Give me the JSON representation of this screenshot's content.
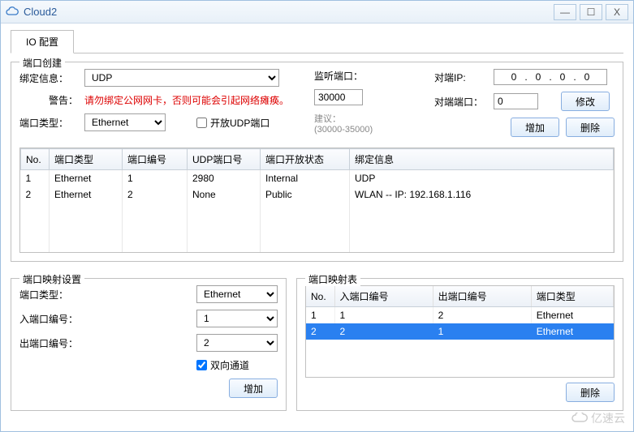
{
  "window": {
    "title": "Cloud2"
  },
  "tabs": {
    "io_config": "IO 配置"
  },
  "port_create": {
    "title": "端口创建",
    "bind_label": "绑定信息：",
    "bind_value": "UDP",
    "warn_label": "警告：",
    "warn_text": "请勿绑定公网网卡，否则可能会引起网络瘫痪。",
    "type_label": "端口类型：",
    "type_value": "Ethernet",
    "open_udp_label": "开放UDP端口",
    "listen_label": "监听端口：",
    "listen_value": "30000",
    "suggest_label": "建议：",
    "suggest_range": "(30000-35000)",
    "peer_ip_label": "对端IP:",
    "peer_ip_value": "0   .   0   .   0   .   0",
    "peer_port_label": "对端端口：",
    "peer_port_value": "0",
    "modify_btn": "修改",
    "add_btn": "增加",
    "del_btn": "删除",
    "cols": {
      "no": "No.",
      "type": "端口类型",
      "num": "端口编号",
      "udp": "UDP端口号",
      "state": "端口开放状态",
      "bind": "绑定信息"
    },
    "rows": [
      {
        "no": "1",
        "type": "Ethernet",
        "num": "1",
        "udp": "2980",
        "state": "Internal",
        "bind": "UDP"
      },
      {
        "no": "2",
        "type": "Ethernet",
        "num": "2",
        "udp": "None",
        "state": "Public",
        "bind": "WLAN -- IP: 192.168.1.116"
      }
    ]
  },
  "port_map_cfg": {
    "title": "端口映射设置",
    "type_label": "端口类型：",
    "type_value": "Ethernet",
    "in_label": "入端口编号：",
    "in_value": "1",
    "out_label": "出端口编号：",
    "out_value": "2",
    "bidir_label": "双向通道",
    "add_btn": "增加"
  },
  "port_map_tbl": {
    "title": "端口映射表",
    "cols": {
      "no": "No.",
      "in": "入端口编号",
      "out": "出端口编号",
      "type": "端口类型"
    },
    "rows": [
      {
        "no": "1",
        "in": "1",
        "out": "2",
        "type": "Ethernet",
        "selected": false
      },
      {
        "no": "2",
        "in": "2",
        "out": "1",
        "type": "Ethernet",
        "selected": true
      }
    ],
    "del_btn": "删除"
  },
  "watermark": "亿速云"
}
